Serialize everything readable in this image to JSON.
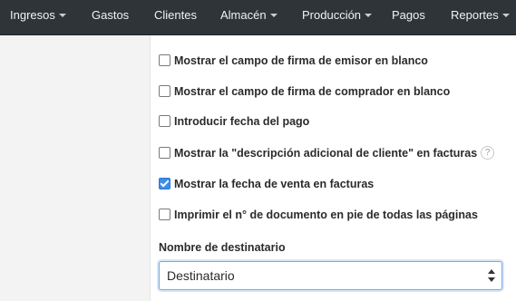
{
  "nav": {
    "items": [
      {
        "label": "Ingresos",
        "dropdown": true
      },
      {
        "label": "Gastos",
        "dropdown": false
      },
      {
        "label": "Clientes",
        "dropdown": false
      },
      {
        "label": "Almacén",
        "dropdown": true
      },
      {
        "label": "Producción",
        "dropdown": true
      },
      {
        "label": "Pagos",
        "dropdown": false
      },
      {
        "label": "Reportes",
        "dropdown": true
      }
    ]
  },
  "options": [
    {
      "label": "Mostrar el campo de firma de emisor en blanco",
      "checked": false
    },
    {
      "label": "Mostrar el campo de firma de comprador en blanco",
      "checked": false
    },
    {
      "label": "Introducir fecha del pago",
      "checked": false
    },
    {
      "label": "Mostrar la \"descripción adicional de cliente\" en facturas",
      "checked": false,
      "help": "?"
    },
    {
      "label": "Mostrar la fecha de venta en facturas",
      "checked": true
    },
    {
      "label": "Imprimir el n° de documento en pie de todas las páginas",
      "checked": false
    }
  ],
  "recipient": {
    "label": "Nombre de destinatario",
    "selected": "Destinatario"
  },
  "colors": {
    "navbar": "#2f3439",
    "checkbox_checked": "#3b8dec",
    "sidebar": "#f3f3f3"
  }
}
